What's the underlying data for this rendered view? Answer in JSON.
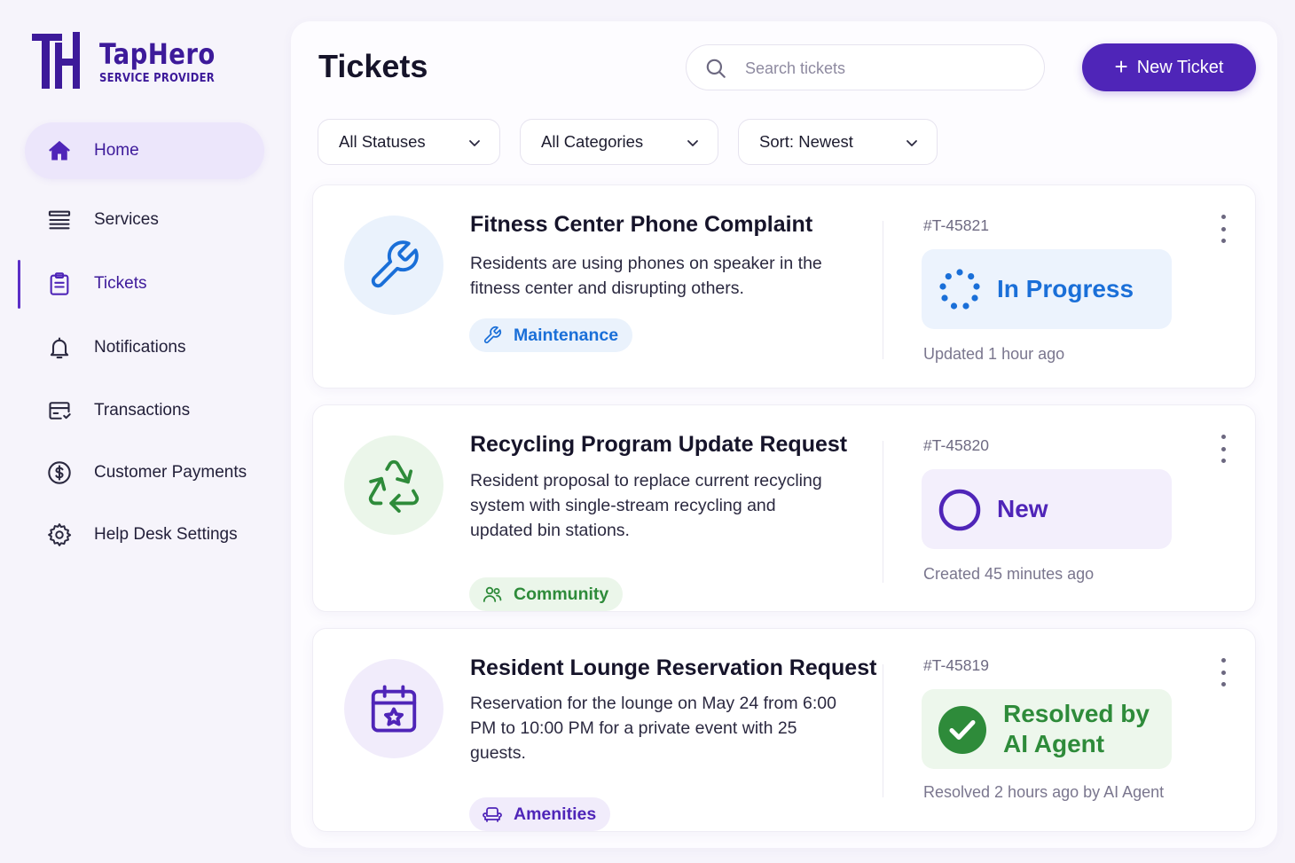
{
  "brand": {
    "name": "TapHero",
    "tagline": "SERVICE PROVIDER",
    "color": "#3d1a9a",
    "accent": "#4f25b8"
  },
  "sidebar": {
    "items": [
      {
        "label": "Home",
        "icon": "home-icon",
        "state": "highlighted"
      },
      {
        "label": "Services",
        "icon": "services-list-icon"
      },
      {
        "label": "Tickets",
        "icon": "clipboard-icon",
        "state": "active"
      },
      {
        "label": "Notifications",
        "icon": "bell-icon"
      },
      {
        "label": "Transactions",
        "icon": "card-icon"
      },
      {
        "label": "Customer Payments",
        "icon": "dollar-circle-icon"
      },
      {
        "label": "Help Desk Settings",
        "icon": "gear-icon"
      }
    ]
  },
  "header": {
    "title": "Tickets",
    "search_placeholder": "Search tickets",
    "new_ticket_label": "New Ticket"
  },
  "filters": [
    {
      "label": "All Statuses"
    },
    {
      "label": "All Categories"
    },
    {
      "label": "Sort: Newest"
    }
  ],
  "tickets": [
    {
      "title": "Fitness Center Phone Complaint",
      "description": "Residents are using phones on speaker in the fitness center and disrupting others.",
      "category": "Maintenance",
      "category_icon": "wrench-icon",
      "icon": "wrench-icon",
      "id": "#T-45821",
      "status": "In Progress",
      "status_icon": "spinner-icon",
      "status_color": "#1a6fd8",
      "updated": "Updated 1 hour ago"
    },
    {
      "title": "Recycling Program Update Request",
      "description": "Resident proposal to replace current recycling system with single-stream recycling and updated bin stations.",
      "category": "Community",
      "category_icon": "people-icon",
      "icon": "recycle-icon",
      "id": "#T-45820",
      "status": "New",
      "status_icon": "circle-icon",
      "status_color": "#4f25b8",
      "updated": "Created 45 minutes ago"
    },
    {
      "title": "Resident Lounge Reservation Request",
      "description": "Reservation for the lounge on May 24 from 6:00 PM to 10:00 PM for a private event with 25 guests.",
      "category": "Amenities",
      "category_icon": "armchair-icon",
      "icon": "calendar-star-icon",
      "id": "#T-45819",
      "status": "Resolved by AI Agent",
      "status_icon": "check-circle-icon",
      "status_color": "#2e8b3a",
      "updated": "Resolved 2 hours ago by AI Agent"
    }
  ]
}
